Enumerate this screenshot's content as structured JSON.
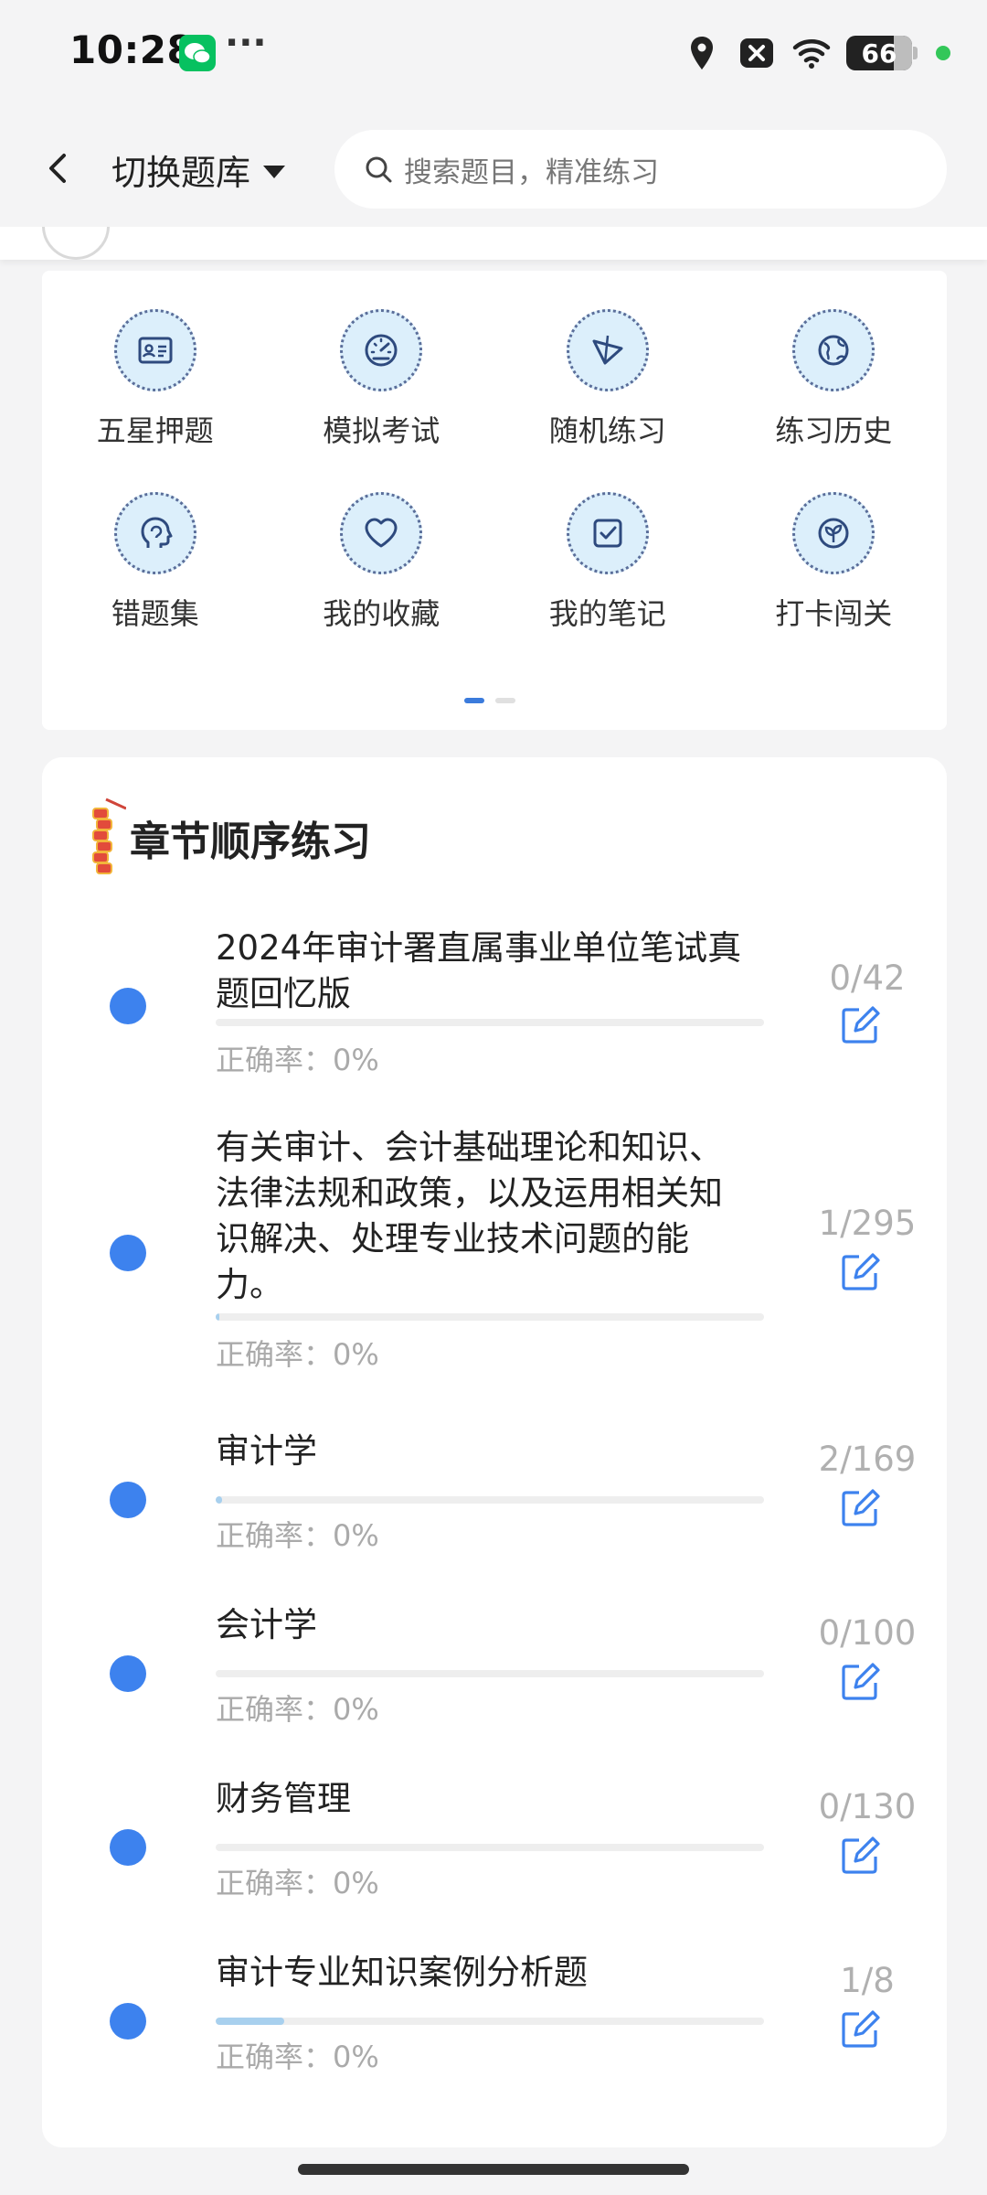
{
  "status_bar": {
    "time": "10:28",
    "battery": "66",
    "icons": [
      "wechat-icon",
      "location-icon",
      "close-box-icon",
      "wifi-icon",
      "battery-icon"
    ]
  },
  "header": {
    "switch_label": "切换题库",
    "search_placeholder": "搜索题目，精准练习"
  },
  "grid": [
    {
      "label": "五星押题",
      "icon": "id-card-icon"
    },
    {
      "label": "模拟考试",
      "icon": "gauge-icon"
    },
    {
      "label": "随机练习",
      "icon": "shuffle-icon"
    },
    {
      "label": "练习历史",
      "icon": "globe-icon"
    },
    {
      "label": "错题集",
      "icon": "head-icon"
    },
    {
      "label": "我的收藏",
      "icon": "heart-icon"
    },
    {
      "label": "我的笔记",
      "icon": "note-check-icon"
    },
    {
      "label": "打卡闯关",
      "icon": "leaf-icon"
    }
  ],
  "pager": {
    "pages": 2,
    "active": 0
  },
  "chapter_section": {
    "title": "章节顺序练习",
    "chapters": [
      {
        "name": "2024年审计署直属事业单位笔试真题回忆版",
        "done": 0,
        "total": 42,
        "count": "0/42",
        "accuracy": "正确率：0%"
      },
      {
        "name": "有关审计、会计基础理论和知识、法律法规和政策，以及运用相关知识解决、处理专业技术问题的能力。",
        "done": 1,
        "total": 295,
        "count": "1/295",
        "accuracy": "正确率：0%"
      },
      {
        "name": "审计学",
        "done": 2,
        "total": 169,
        "count": "2/169",
        "accuracy": "正确率：0%"
      },
      {
        "name": "会计学",
        "done": 0,
        "total": 100,
        "count": "0/100",
        "accuracy": "正确率：0%"
      },
      {
        "name": "财务管理",
        "done": 0,
        "total": 130,
        "count": "0/130",
        "accuracy": "正确率：0%"
      },
      {
        "name": "审计专业知识案例分析题",
        "done": 1,
        "total": 8,
        "count": "1/8",
        "accuracy": "正确率：0%"
      }
    ]
  },
  "colors": {
    "accent": "#3d82ee",
    "progress": "#a8d0ee",
    "icon_bg": "#dceffb",
    "icon_stroke": "#2e4a7e"
  }
}
